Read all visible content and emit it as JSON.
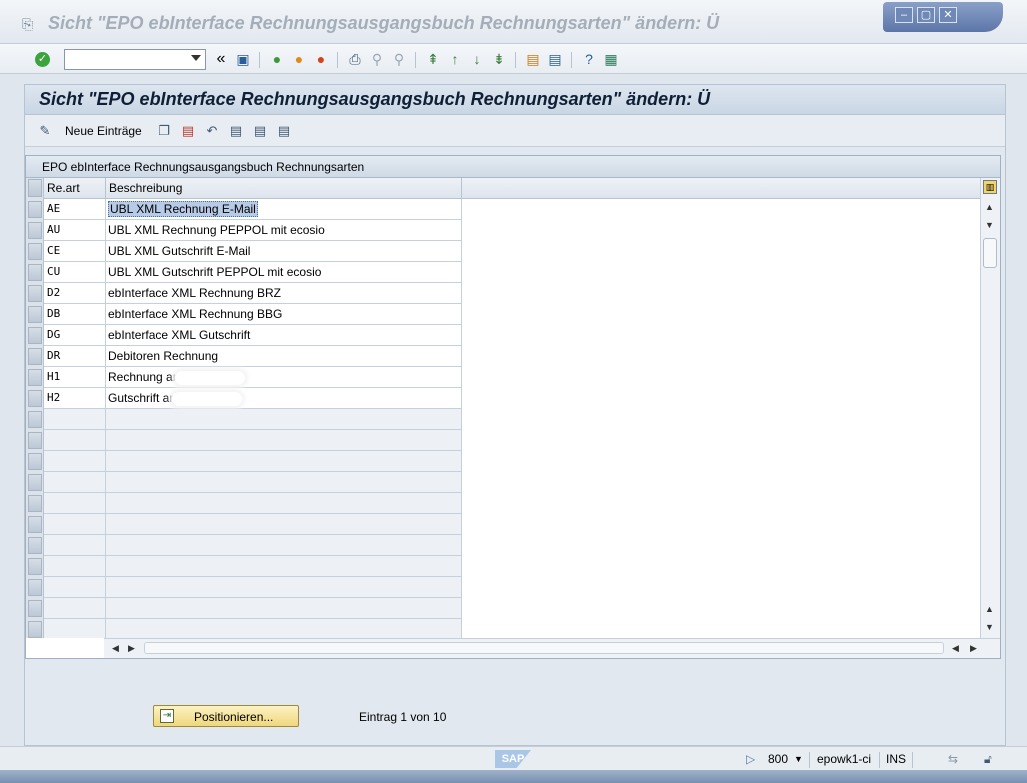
{
  "window": {
    "title": "Sicht \"EPO ebInterface Rechnungsausgangsbuch Rechnungsarten\" ändern: Ü",
    "buttons": [
      "minimize",
      "maximize",
      "close"
    ]
  },
  "system_toolbar": {
    "command_field": {
      "value": "",
      "placeholder": ""
    },
    "back_label": "«"
  },
  "screen": {
    "title": "Sicht \"EPO ebInterface Rechnungsausgangsbuch Rechnungsarten\" ändern: Ü",
    "neue_eintraege": "Neue Einträge"
  },
  "table": {
    "title": "EPO ebInterface Rechnungsausgangsbuch Rechnungsarten",
    "columns": [
      "Re.art",
      "Beschreibung"
    ],
    "rows": [
      {
        "code": "AE",
        "desc": "UBL XML Rechnung E-Mail"
      },
      {
        "code": "AU",
        "desc": "UBL XML Rechnung PEPPOL mit ecosio"
      },
      {
        "code": "CE",
        "desc": "UBL XML Gutschrift E-Mail"
      },
      {
        "code": "CU",
        "desc": "UBL XML Gutschrift PEPPOL mit ecosio"
      },
      {
        "code": "D2",
        "desc": "ebInterface XML Rechnung BRZ"
      },
      {
        "code": "DB",
        "desc": "ebInterface XML Rechnung BBG"
      },
      {
        "code": "DG",
        "desc": "ebInterface XML Gutschrift"
      },
      {
        "code": "DR",
        "desc": "Debitoren Rechnung"
      },
      {
        "code": "H1",
        "desc": "Rechnung an"
      },
      {
        "code": "H2",
        "desc": "Gutschrift an"
      }
    ]
  },
  "footer": {
    "position_button": "Positionieren...",
    "entry_info": "Eintrag 1 von 10"
  },
  "status_bar": {
    "sap_logo": "SAP",
    "client": "800",
    "server": "epowk1-ci",
    "mode": "INS"
  }
}
